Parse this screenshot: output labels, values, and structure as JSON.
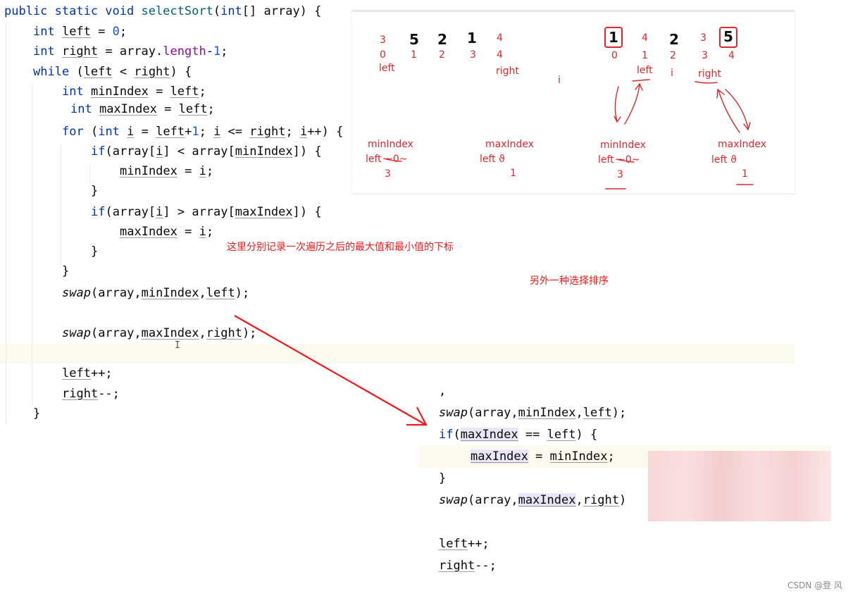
{
  "main_code": {
    "lines": [
      [
        [
          "public static void ",
          "kw"
        ],
        [
          "selectSort",
          "fn"
        ],
        [
          "(",
          "p"
        ],
        [
          "int",
          "kw"
        ],
        [
          "[] array) {",
          "p"
        ]
      ],
      [
        [
          "int ",
          "kw"
        ],
        [
          "left",
          "var"
        ],
        [
          " = ",
          "p"
        ],
        [
          "0",
          "num"
        ],
        [
          ";",
          "p"
        ]
      ],
      [
        [
          "int ",
          "kw"
        ],
        [
          "right",
          "var"
        ],
        [
          " = array.",
          "p"
        ],
        [
          "length",
          "field"
        ],
        [
          "-",
          "p"
        ],
        [
          "1",
          "num"
        ],
        [
          ";",
          "p"
        ]
      ],
      [
        [
          "while ",
          "kw"
        ],
        [
          "(",
          "p"
        ],
        [
          "left",
          "var"
        ],
        [
          " < ",
          "p"
        ],
        [
          "right",
          "var"
        ],
        [
          ") {",
          "p"
        ]
      ],
      [
        [
          "int ",
          "kw"
        ],
        [
          "minIndex",
          "var"
        ],
        [
          " = ",
          "p"
        ],
        [
          "left",
          "var"
        ],
        [
          ";",
          "p"
        ]
      ],
      [
        [
          "int ",
          "kw"
        ],
        [
          "maxIndex",
          "var"
        ],
        [
          " = ",
          "p"
        ],
        [
          "left",
          "var"
        ],
        [
          ";",
          "p"
        ]
      ],
      [
        [
          "for ",
          "kw"
        ],
        [
          "(",
          "p"
        ],
        [
          "int ",
          "kw"
        ],
        [
          "i",
          "var"
        ],
        [
          " = ",
          "p"
        ],
        [
          "left",
          "var"
        ],
        [
          "+",
          "p"
        ],
        [
          "1",
          "num"
        ],
        [
          "; ",
          "p"
        ],
        [
          "i",
          "var"
        ],
        [
          " <= ",
          "p"
        ],
        [
          "right",
          "var"
        ],
        [
          "; ",
          "p"
        ],
        [
          "i",
          "var"
        ],
        [
          "++) {",
          "p"
        ]
      ],
      [
        [
          "if",
          "kw"
        ],
        [
          "(array[",
          "p"
        ],
        [
          "i",
          "var"
        ],
        [
          "] < array[",
          "p"
        ],
        [
          "minIndex",
          "var"
        ],
        [
          "]) {",
          "p"
        ]
      ],
      [
        [
          "minIndex",
          "var"
        ],
        [
          " = ",
          "p"
        ],
        [
          "i",
          "var"
        ],
        [
          ";",
          "p"
        ]
      ],
      [
        [
          "}",
          "p"
        ]
      ],
      [
        [
          "if",
          "kw"
        ],
        [
          "(array[",
          "p"
        ],
        [
          "i",
          "var"
        ],
        [
          "] > array[",
          "p"
        ],
        [
          "maxIndex",
          "var"
        ],
        [
          "]) {",
          "p"
        ]
      ],
      [
        [
          "maxIndex",
          "var"
        ],
        [
          " = ",
          "p"
        ],
        [
          "i",
          "var"
        ],
        [
          ";",
          "p"
        ]
      ],
      [
        [
          "}",
          "p"
        ]
      ],
      [
        [
          "}",
          "p"
        ]
      ],
      [
        [
          "swap",
          "it"
        ],
        [
          "(array,",
          "p"
        ],
        [
          "minIndex",
          "var"
        ],
        [
          ",",
          "p"
        ],
        [
          "left",
          "var"
        ],
        [
          ");",
          "p"
        ]
      ],
      [
        [
          "swap",
          "it"
        ],
        [
          "(array,",
          "p"
        ],
        [
          "maxIndex",
          "var"
        ],
        [
          ",",
          "p"
        ],
        [
          "right",
          "var"
        ],
        [
          ");",
          "p"
        ]
      ],
      [
        [
          "left",
          "var"
        ],
        [
          "++;",
          "p"
        ]
      ],
      [
        [
          "right",
          "var"
        ],
        [
          "--;",
          "p"
        ]
      ],
      [
        [
          "}",
          "p"
        ]
      ]
    ]
  },
  "alt_code": {
    "lines": [
      [
        [
          ",",
          "p"
        ]
      ],
      [
        [
          "swap",
          "it"
        ],
        [
          "(array,",
          "p"
        ],
        [
          "minIndex",
          "var"
        ],
        [
          ",",
          "p"
        ],
        [
          "left",
          "var"
        ],
        [
          ");",
          "p"
        ]
      ],
      [
        [
          "if",
          "kw"
        ],
        [
          "(",
          "p"
        ],
        [
          "maxIndex",
          "varhl"
        ],
        [
          " == ",
          "p"
        ],
        [
          "left",
          "var"
        ],
        [
          ") {",
          "p"
        ]
      ],
      [
        [
          "maxIndex",
          "varhl"
        ],
        [
          " = ",
          "p"
        ],
        [
          "minIndex",
          "var"
        ],
        [
          ";",
          "p"
        ]
      ],
      [
        [
          "}",
          "p"
        ]
      ],
      [
        [
          "swap",
          "it"
        ],
        [
          "(array,",
          "p"
        ],
        [
          "maxIndex",
          "varhl"
        ],
        [
          ",",
          "p"
        ],
        [
          "right",
          "var"
        ],
        [
          ")",
          "p"
        ]
      ],
      [
        [
          "left",
          "var"
        ],
        [
          "++;",
          "p"
        ]
      ],
      [
        [
          "right",
          "var"
        ],
        [
          "--;",
          "p"
        ]
      ]
    ]
  },
  "diagram": {
    "before": {
      "values": [
        "3",
        "5",
        "2",
        "1",
        "4"
      ],
      "indices": [
        "0",
        "1",
        "2",
        "3",
        "4"
      ],
      "left_label": "left",
      "right_label": "right",
      "i_label": "i",
      "min": {
        "title": "minIndex",
        "line": "left ~0~",
        "value": "3"
      },
      "max": {
        "title": "maxIndex",
        "line": "left  ϑ",
        "value": "1"
      }
    },
    "after": {
      "values": [
        "1",
        "4",
        "2",
        "3",
        "5"
      ],
      "indices": [
        "0",
        "1",
        "2",
        "3",
        "4"
      ],
      "left_label": "left",
      "i_label": "i",
      "right_label": "right",
      "min": {
        "title": "minIndex",
        "line": "left ~0~",
        "value": "3"
      },
      "max": {
        "title": "maxIndex",
        "line": "left  ϑ",
        "value": "1"
      }
    }
  },
  "notes": {
    "record_indices": "这里分别记录一次遍历之后的最大值和最小值的下标",
    "another_sort": "另外一种选择排序"
  },
  "watermark": "CSDN @登 风",
  "colors": {
    "annotation": "#e0262b",
    "keyword": "#0033b3",
    "method": "#00627a",
    "field": "#871094",
    "number": "#1750eb",
    "current_line": "#fcf9ee"
  }
}
